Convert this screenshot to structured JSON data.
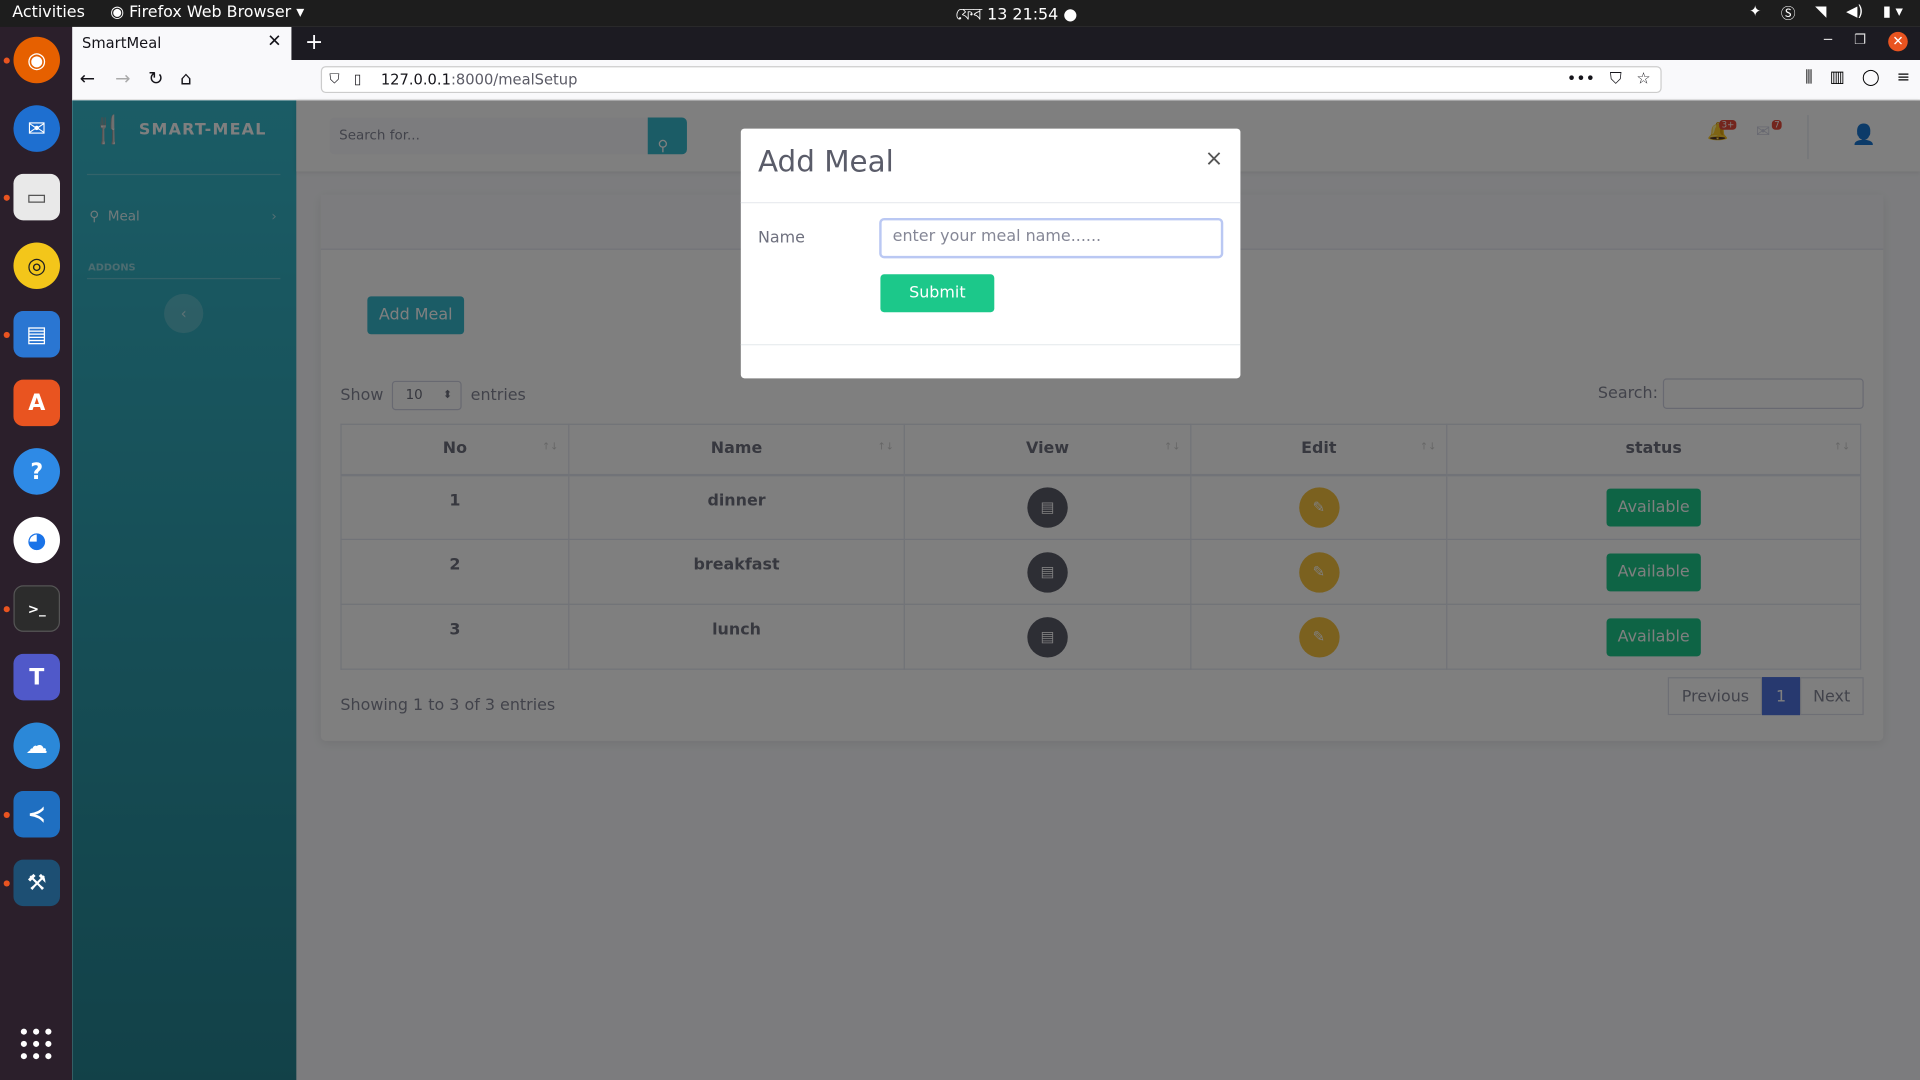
{
  "system": {
    "activities": "Activities",
    "app_menu": "Firefox Web Browser",
    "clock": "ফেব 13  21:54"
  },
  "browser": {
    "tab_title": "SmartMeal",
    "url_host": "127.0.0.1",
    "url_path": ":8000/mealSetup"
  },
  "sidebar": {
    "brand": "SMART-MEAL",
    "items": [
      {
        "label": "Meal"
      }
    ],
    "section": "ADDONS"
  },
  "topbar": {
    "search_placeholder": "Search for...",
    "alerts_badge": "3+",
    "messages_badge": "7"
  },
  "main": {
    "add_button": "Add Meal",
    "show_label": "Show",
    "entries_label": "entries",
    "page_size": "10",
    "search_label": "Search:",
    "columns": [
      "No",
      "Name",
      "View",
      "Edit",
      "status"
    ],
    "rows": [
      {
        "no": "1",
        "name": "dinner",
        "status": "Available"
      },
      {
        "no": "2",
        "name": "breakfast",
        "status": "Available"
      },
      {
        "no": "3",
        "name": "lunch",
        "status": "Available"
      }
    ],
    "info": "Showing 1 to 3 of 3 entries",
    "pagination": {
      "previous": "Previous",
      "current": "1",
      "next": "Next"
    }
  },
  "modal": {
    "title": "Add Meal",
    "close": "×",
    "name_label": "Name",
    "name_placeholder": "enter your meal name......",
    "submit": "Submit"
  },
  "colors": {
    "sidebar": "#36b9cc",
    "success": "#1cc88a",
    "warning": "#f6c23e",
    "primary": "#4e73df"
  }
}
